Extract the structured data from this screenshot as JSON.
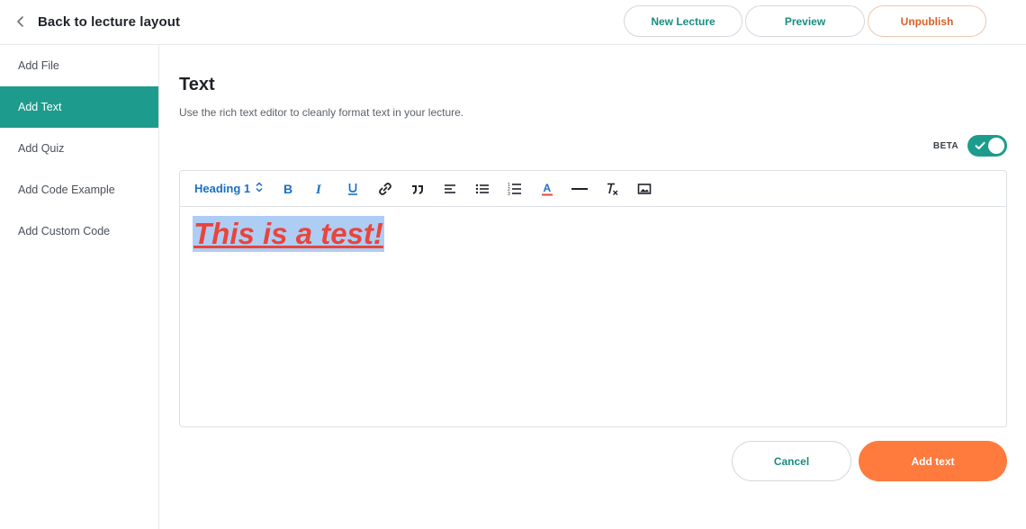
{
  "header": {
    "back_label": "Back to lecture layout",
    "back_icon": "chevron-left-icon",
    "actions": {
      "new_lecture": "New Lecture",
      "preview": "Preview",
      "unpublish": "Unpublish"
    }
  },
  "sidebar": {
    "items": [
      {
        "label": "Add File",
        "active": false
      },
      {
        "label": "Add Text",
        "active": true
      },
      {
        "label": "Add Quiz",
        "active": false
      },
      {
        "label": "Add Code Example",
        "active": false
      },
      {
        "label": "Add Custom Code",
        "active": false
      }
    ]
  },
  "main": {
    "title": "Text",
    "subtitle": "Use the rich text editor to cleanly format text in your lecture.",
    "beta_label": "BETA",
    "beta_enabled": true
  },
  "editor": {
    "heading_select": "Heading 1",
    "toolbar_icons": [
      "bold-icon",
      "italic-icon",
      "underline-icon",
      "link-icon",
      "blockquote-icon",
      "align-left-icon",
      "bullet-list-icon",
      "numbered-list-icon",
      "text-color-icon",
      "horizontal-rule-icon",
      "clear-format-icon",
      "image-icon"
    ],
    "content_text": "This is a test!"
  },
  "footer": {
    "cancel": "Cancel",
    "add": "Add text"
  },
  "colors": {
    "accent_teal": "#1d9c8d",
    "accent_orange": "#ff7a3d",
    "link_blue": "#1a6fc4",
    "unpublish_text": "#d8602a",
    "content_red": "#e8453c",
    "selection_blue": "#aecdf5"
  }
}
